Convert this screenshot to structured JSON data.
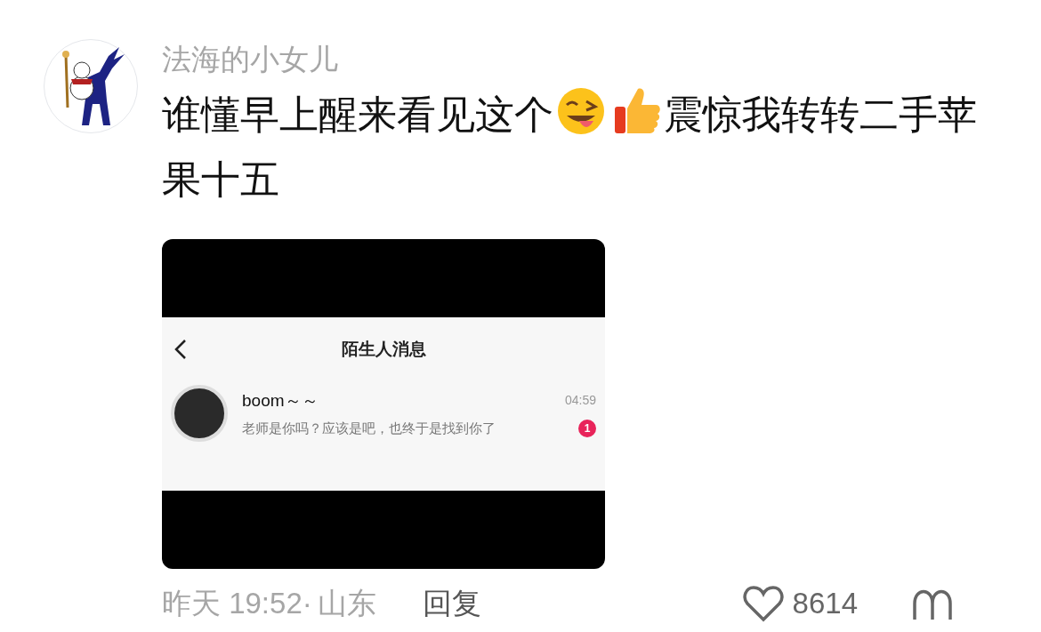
{
  "comment": {
    "username": "法海的小女儿",
    "content": [
      {
        "kind": "text",
        "text": "谁懂早上醒来看见这个"
      },
      {
        "kind": "wink-emoji"
      },
      {
        "kind": "thumbs-up-emoji"
      },
      {
        "kind": "text",
        "text": "震惊我转转二手苹"
      },
      {
        "kind": "text",
        "text": "果十五"
      }
    ],
    "attachment": {
      "header": {
        "title": "陌生人消息"
      },
      "messages": [
        {
          "sender": "boom～～",
          "time": "04:59",
          "preview": "老师是你吗？应该是吧，也终于是找到你了",
          "unread": "1"
        }
      ]
    },
    "meta": {
      "time": "昨天 19:52·",
      "location": "山东",
      "reply": "回复",
      "likes": "8614"
    }
  }
}
